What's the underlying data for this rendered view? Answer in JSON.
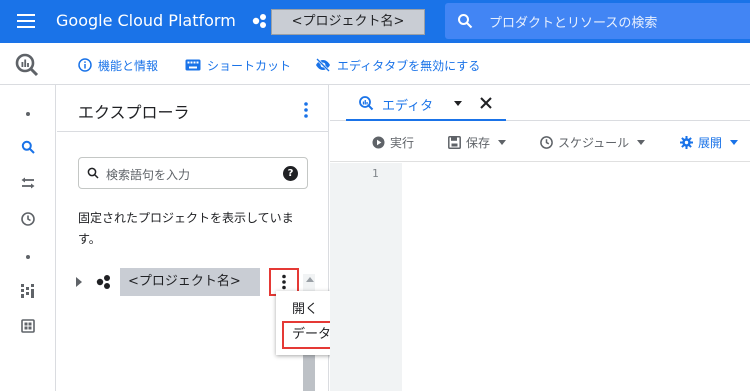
{
  "topbar": {
    "brand": "Google Cloud Platform",
    "project_selector": "<プロジェクト名>",
    "search_placeholder": "プロダクトとリソースの検索"
  },
  "subbar": {
    "links": [
      {
        "label": "機能と情報",
        "icon": "info-icon"
      },
      {
        "label": "ショートカット",
        "icon": "keyboard-icon"
      },
      {
        "label": "エディタタブを無効にする",
        "icon": "eye-off-icon"
      }
    ]
  },
  "rail": {
    "icons": [
      "search-icon",
      "history-transfer-icon",
      "clock-icon",
      "analytics-hub-icon",
      "dashboard-icon"
    ]
  },
  "explorer": {
    "title": "エクスプローラ",
    "search_placeholder": "検索語句を入力",
    "help_glyph": "?",
    "pinned_text": "固定されたプロジェクトを表示しています。",
    "project_name": "<プロジェクト名>"
  },
  "context_menu": {
    "open": "開く",
    "create_dataset": "データセットを作成"
  },
  "editor": {
    "tab_label": "エディタ",
    "toolbar": {
      "run": "実行",
      "save": "保存",
      "schedule": "スケジュール",
      "deploy": "展開"
    },
    "line_number": "1"
  },
  "colors": {
    "primary": "#1a73e8",
    "highlight_border": "#e53935",
    "selection_grey": "#c9cdd4"
  }
}
